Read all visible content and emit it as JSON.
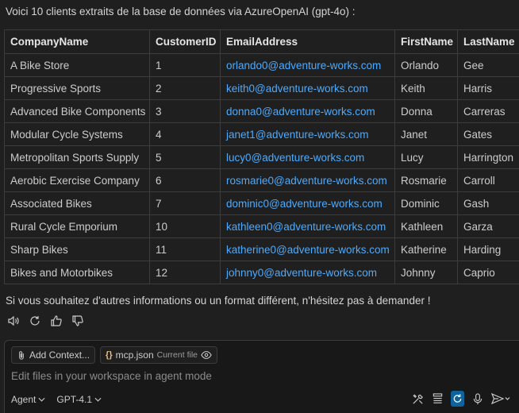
{
  "intro": "Voici 10 clients extraits de la base de données via AzureOpenAI (gpt-4o) :",
  "table": {
    "headers": [
      "CompanyName",
      "CustomerID",
      "EmailAddress",
      "FirstName",
      "LastName"
    ],
    "rows": [
      [
        "A Bike Store",
        "1",
        "orlando0@adventure-works.com",
        "Orlando",
        "Gee"
      ],
      [
        "Progressive Sports",
        "2",
        "keith0@adventure-works.com",
        "Keith",
        "Harris"
      ],
      [
        "Advanced Bike Components",
        "3",
        "donna0@adventure-works.com",
        "Donna",
        "Carreras"
      ],
      [
        "Modular Cycle Systems",
        "4",
        "janet1@adventure-works.com",
        "Janet",
        "Gates"
      ],
      [
        "Metropolitan Sports Supply",
        "5",
        "lucy0@adventure-works.com",
        "Lucy",
        "Harrington"
      ],
      [
        "Aerobic Exercise Company",
        "6",
        "rosmarie0@adventure-works.com",
        "Rosmarie",
        "Carroll"
      ],
      [
        "Associated Bikes",
        "7",
        "dominic0@adventure-works.com",
        "Dominic",
        "Gash"
      ],
      [
        "Rural Cycle Emporium",
        "10",
        "kathleen0@adventure-works.com",
        "Kathleen",
        "Garza"
      ],
      [
        "Sharp Bikes",
        "11",
        "katherine0@adventure-works.com",
        "Katherine",
        "Harding"
      ],
      [
        "Bikes and Motorbikes",
        "12",
        "johnny0@adventure-works.com",
        "Johnny",
        "Caprio"
      ]
    ]
  },
  "outro": "Si vous souhaitez d'autres informations ou un format différent, n'hésitez pas à demander !",
  "message_actions": {
    "icons": [
      "speaker-icon",
      "retry-icon",
      "thumbs-up-icon",
      "thumbs-down-icon"
    ]
  },
  "composer": {
    "add_context_label": "Add Context...",
    "file_chip": {
      "name": "mcp.json",
      "sub": "Current file"
    },
    "placeholder": "Edit files in your workspace in agent mode",
    "mode_label": "Agent",
    "model_label": "GPT-4.1"
  },
  "colors": {
    "background": "#1f1f1f",
    "link": "#4daafc",
    "accent": "#0e639c",
    "border": "#3c3c3c"
  }
}
